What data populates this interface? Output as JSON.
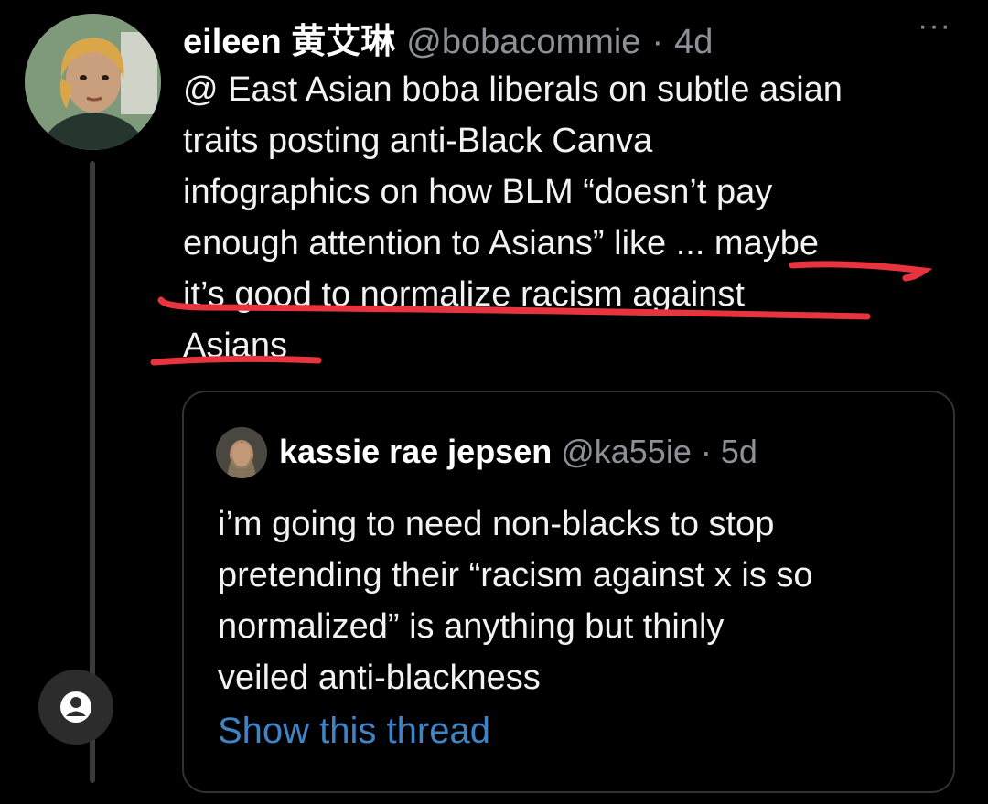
{
  "tweet": {
    "author_name": "eileen 黄艾琳",
    "handle": "@bobacommie",
    "separator": "·",
    "time": "4d",
    "more_label": "···",
    "lines": [
      "@ East Asian boba liberals on subtle asian",
      "traits posting anti-Black Canva",
      "infographics on how BLM “doesn’t pay",
      "enough attention to Asians” like ... maybe",
      "it’s good to normalize racism against",
      "Asians"
    ]
  },
  "quoted_tweet": {
    "author_name": "kassie rae jepsen",
    "handle": "@ka55ie",
    "separator": "·",
    "time": "5d",
    "lines": [
      "i’m going to need non-blacks to stop",
      "pretending their “racism against x is so",
      "normalized” is anything but thinly",
      "veiled anti-blackness"
    ],
    "show_thread_label": "Show this thread"
  },
  "icons": {
    "more": "more-icon",
    "profile": "profile-icon"
  },
  "colors": {
    "background": "#000000",
    "secondary_text": "#8b9197",
    "link": "#3d85c6",
    "annotation": "#e8343f"
  }
}
